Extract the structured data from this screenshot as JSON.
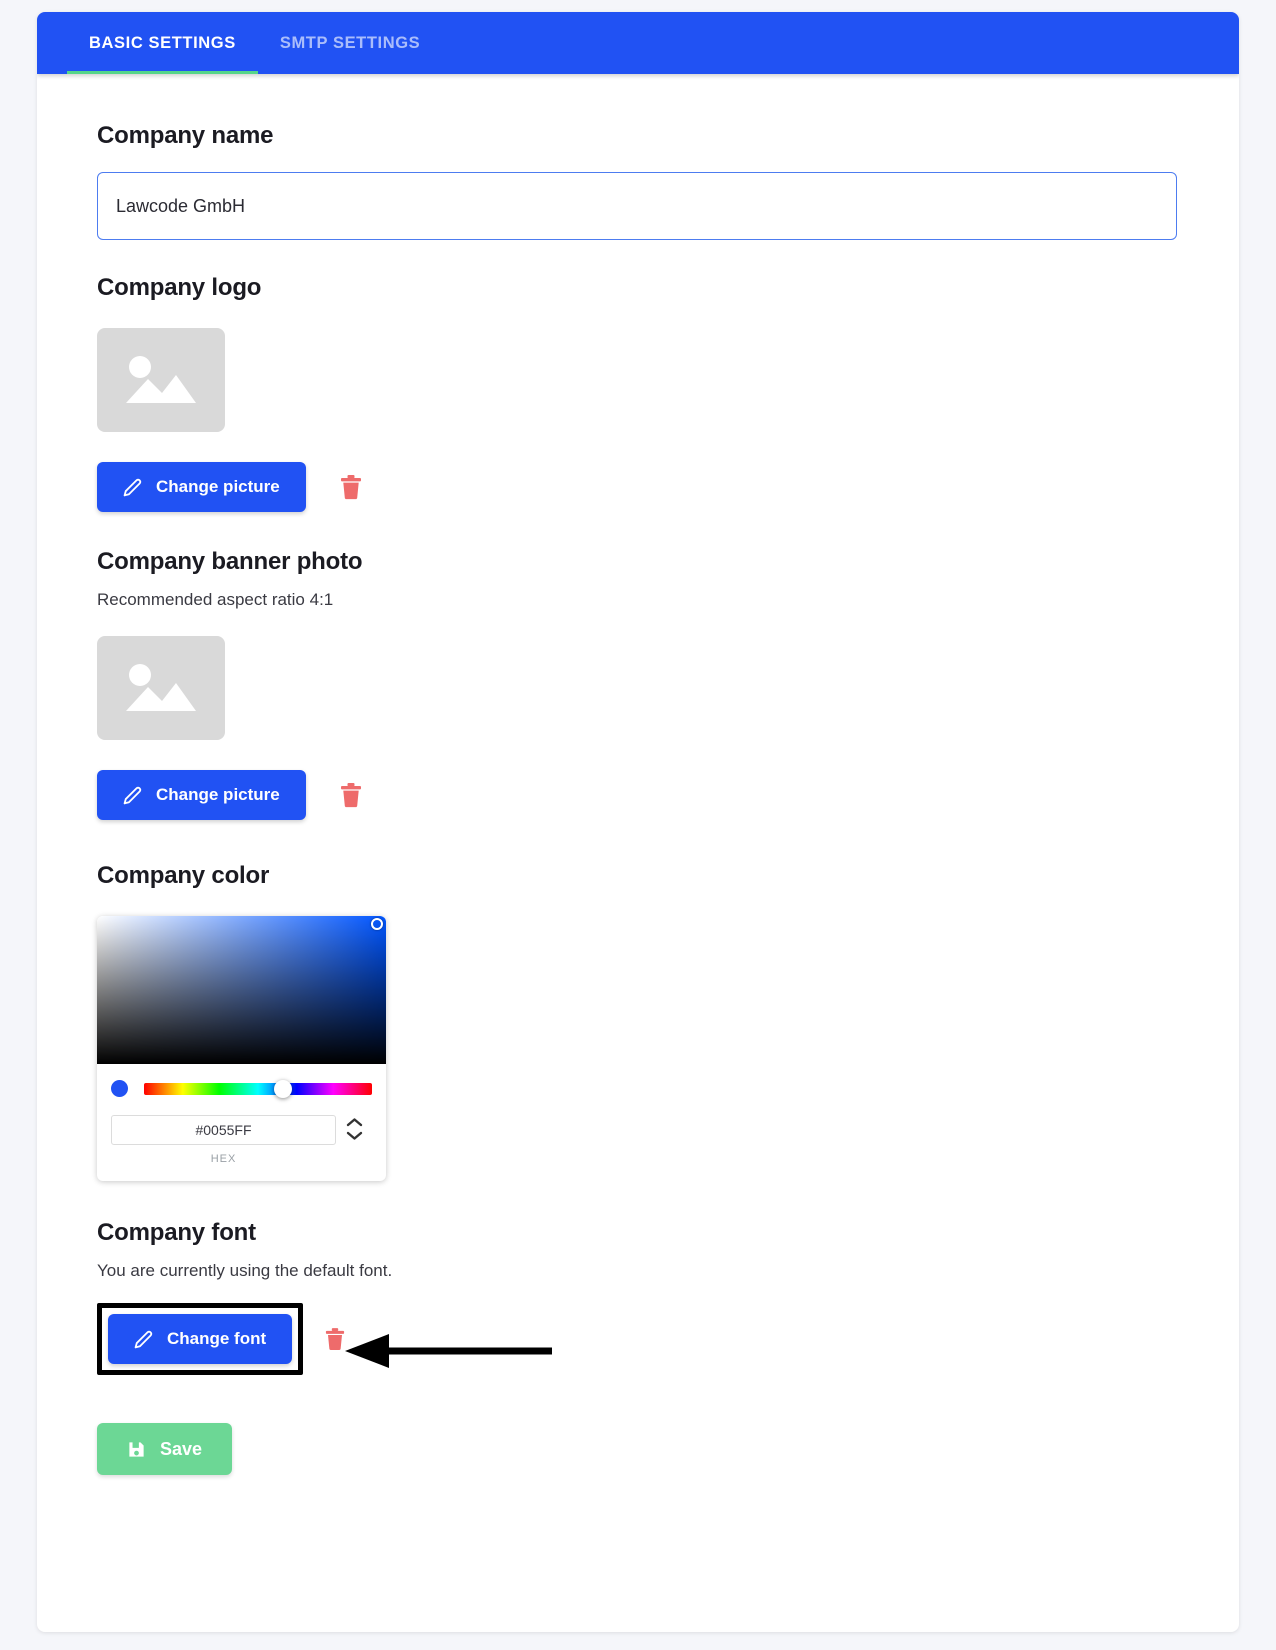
{
  "tabs": [
    {
      "label": "BASIC SETTINGS",
      "active": true
    },
    {
      "label": "SMTP SETTINGS",
      "active": false
    }
  ],
  "company_name": {
    "heading": "Company name",
    "value": "Lawcode GmbH",
    "placeholder": "Company name"
  },
  "company_logo": {
    "heading": "Company logo",
    "change_label": "Change picture",
    "placeholder_icon": "image-placeholder-icon",
    "delete_icon": "trash-icon",
    "edit_icon": "pencil-icon"
  },
  "company_banner": {
    "heading": "Company banner photo",
    "subtext": "Recommended aspect ratio 4:1",
    "change_label": "Change picture",
    "placeholder_icon": "image-placeholder-icon",
    "delete_icon": "trash-icon",
    "edit_icon": "pencil-icon"
  },
  "company_color": {
    "heading": "Company color",
    "hex_value": "#0055FF",
    "hex_label": "HEX",
    "swatch_color": "#2152F3",
    "stepper_up_icon": "chevron-up-icon",
    "stepper_down_icon": "chevron-down-icon"
  },
  "company_font": {
    "heading": "Company font",
    "subtext": "You are currently using the default font.",
    "change_label": "Change font",
    "delete_icon": "trash-icon",
    "edit_icon": "pencil-icon"
  },
  "footer": {
    "save_label": "Save",
    "save_icon": "floppy-disk-icon",
    "save_color": "#6CD795"
  },
  "theme": {
    "tab_bar_color": "#2152F3",
    "active_tab_underline": "#56D58A",
    "primary_button": "#2152F3",
    "trash_color": "#EE6B6B",
    "page_background": "#F5F6FA"
  },
  "annotation": {
    "type": "arrow-pointing-left",
    "target": "change-font-button"
  }
}
